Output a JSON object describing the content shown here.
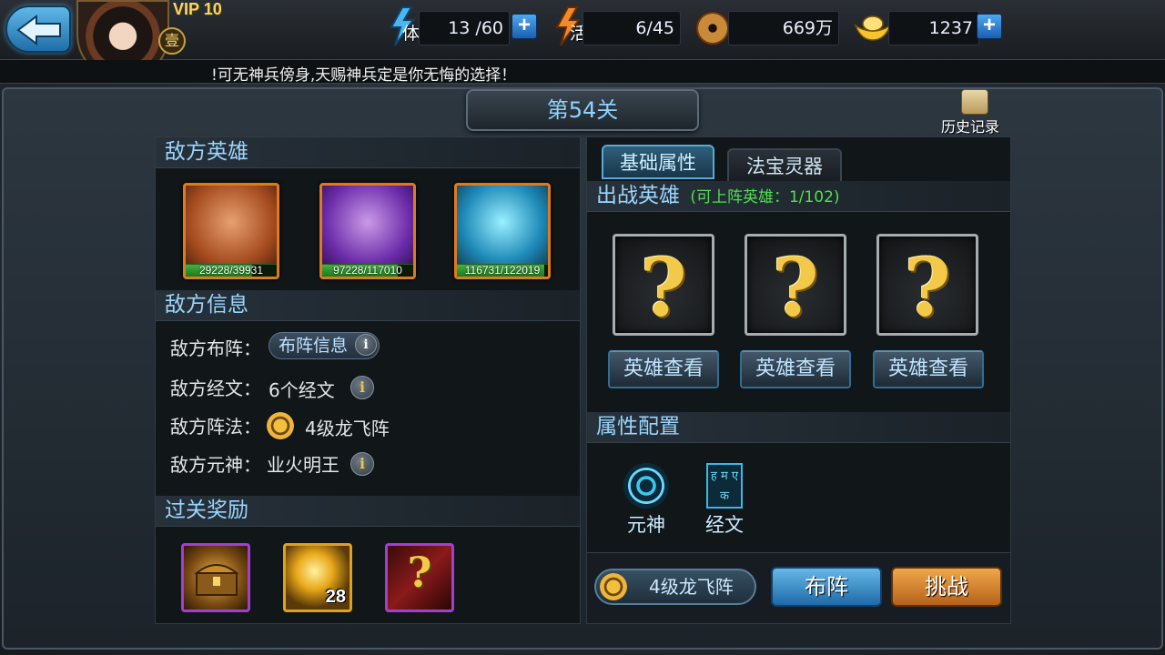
{
  "header": {
    "vip_label": "VIP 10",
    "vip_rank": "壹",
    "stamina": {
      "icon": "stamina-bolt-icon",
      "label": "体",
      "value": "13 /60"
    },
    "energy": {
      "icon": "energy-bolt-icon",
      "label": "活",
      "value": "6/45"
    },
    "copper": {
      "icon": "copper-coin-icon",
      "value": "669万"
    },
    "gold": {
      "icon": "gold-ingot-icon",
      "value": "1237"
    },
    "plus_label": "+"
  },
  "marquee": {
    "text": "!可无神兵傍身,天赐神兵定是你无悔的选择！"
  },
  "stage": {
    "title": "第54关",
    "history_label": "历史记录"
  },
  "enemy": {
    "heroes_heading": "敌方英雄",
    "heroes": [
      {
        "hp": "29228/39931",
        "hp_fraction": 0.732,
        "art": "bald-warrior-portrait"
      },
      {
        "hp": "97228/117010",
        "hp_fraction": 0.831,
        "art": "purple-demon-portrait"
      },
      {
        "hp": "116731/122019",
        "hp_fraction": 0.957,
        "art": "ice-golem-portrait"
      }
    ],
    "info_heading": "敌方信息",
    "formation_label": "敌方布阵：",
    "formation_button": "布阵信息",
    "scripture_label": "敌方经文：",
    "scripture_value": "6个经文",
    "array_label": "敌方阵法：",
    "array_value": "4级龙飞阵",
    "spirit_label": "敌方元神：",
    "spirit_value": "业火明王",
    "info_icon": "i",
    "rewards_heading": "过关奖励",
    "rewards": [
      {
        "art": "treasure-chest-icon",
        "count": ""
      },
      {
        "art": "golden-orb-icon",
        "count": "28"
      },
      {
        "art": "mystery-book-icon",
        "count": ""
      }
    ]
  },
  "right": {
    "tabs": [
      {
        "label": "基础属性",
        "active": true
      },
      {
        "label": "法宝灵器",
        "active": false
      }
    ],
    "battle_heading": "出战英雄",
    "battle_sub": "(可上阵英雄：1/102)",
    "slots": [
      {
        "symbol": "?",
        "button": "英雄查看"
      },
      {
        "symbol": "?",
        "button": "英雄查看"
      },
      {
        "symbol": "?",
        "button": "英雄查看"
      }
    ],
    "attr_heading": "属性配置",
    "attr_items": [
      {
        "label": "元神",
        "icon": "spirit-swirl-icon"
      },
      {
        "label": "经文",
        "icon": "scripture-book-icon",
        "glyphs": "ह म ए क"
      }
    ],
    "formation_pill": "4级龙飞阵",
    "deploy_button": "布阵",
    "challenge_button": "挑战"
  }
}
